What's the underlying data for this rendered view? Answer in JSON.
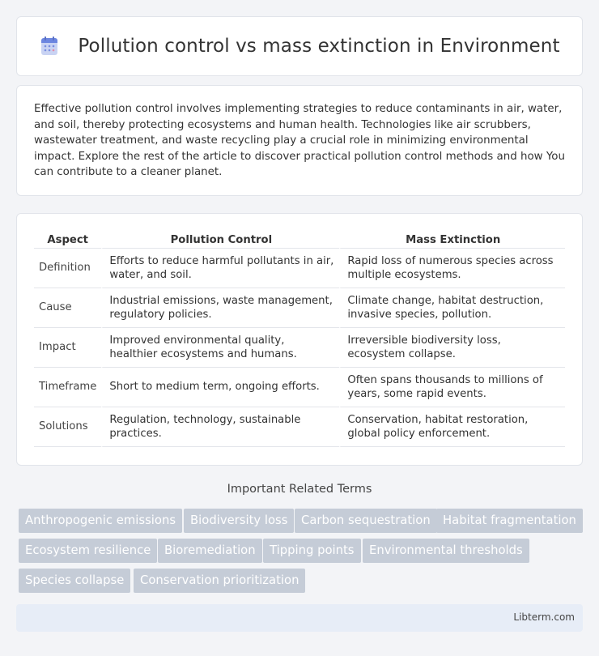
{
  "header": {
    "title": "Pollution control vs mass extinction in Environment",
    "icon": "document-list-icon"
  },
  "intro": {
    "text": "Effective pollution control involves implementing strategies to reduce contaminants in air, water, and soil, thereby protecting ecosystems and human health. Technologies like air scrubbers, wastewater treatment, and waste recycling play a crucial role in minimizing environmental impact. Explore the rest of the article to discover practical pollution control methods and how You can contribute to a cleaner planet."
  },
  "table": {
    "headers": [
      "Aspect",
      "Pollution Control",
      "Mass Extinction"
    ],
    "rows": [
      [
        "Definition",
        "Efforts to reduce harmful pollutants in air, water, and soil.",
        "Rapid loss of numerous species across multiple ecosystems."
      ],
      [
        "Cause",
        "Industrial emissions, waste management, regulatory policies.",
        "Climate change, habitat destruction, invasive species, pollution."
      ],
      [
        "Impact",
        "Improved environmental quality, healthier ecosystems and humans.",
        "Irreversible biodiversity loss, ecosystem collapse."
      ],
      [
        "Timeframe",
        "Short to medium term, ongoing efforts.",
        "Often spans thousands to millions of years, some rapid events."
      ],
      [
        "Solutions",
        "Regulation, technology, sustainable practices.",
        "Conservation, habitat restoration, global policy enforcement."
      ]
    ]
  },
  "related": {
    "title": "Important Related Terms",
    "tags": [
      "Anthropogenic emissions",
      "Biodiversity loss",
      "Carbon sequestration",
      "Habitat fragmentation",
      "Ecosystem resilience",
      "Bioremediation",
      "Tipping points",
      "Environmental thresholds",
      "Species collapse",
      "Conservation prioritization"
    ]
  },
  "footer": {
    "site": "Libterm.com"
  },
  "colors": {
    "tag_bg": "#c5ccd7",
    "footer_bg": "#e7edf7",
    "page_bg": "#f3f4f7"
  }
}
